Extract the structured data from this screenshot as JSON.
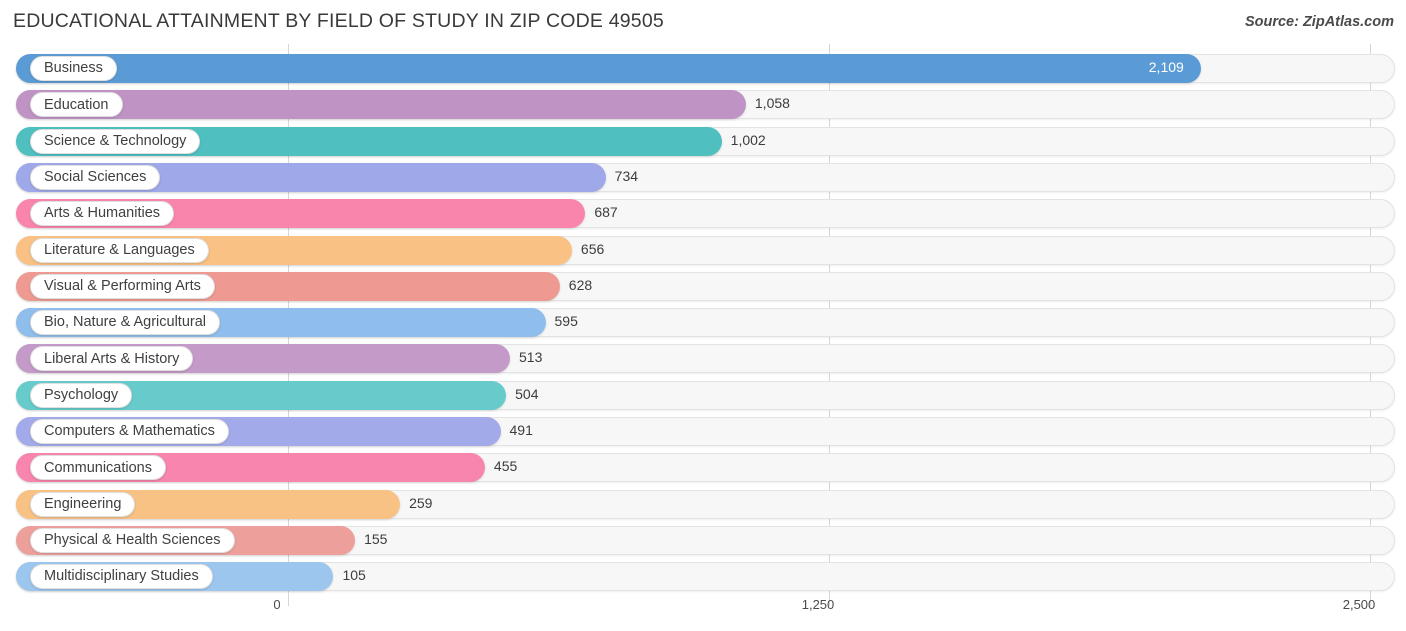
{
  "header": {
    "title": "EDUCATIONAL ATTAINMENT BY FIELD OF STUDY IN ZIP CODE 49505",
    "source": "Source: ZipAtlas.com"
  },
  "chart_data": {
    "type": "bar",
    "orientation": "horizontal",
    "title": "EDUCATIONAL ATTAINMENT BY FIELD OF STUDY IN ZIP CODE 49505",
    "xlabel": "",
    "ylabel": "",
    "xlim": [
      0,
      2500
    ],
    "grid": true,
    "legend": "none",
    "xticks": [
      "0",
      "1,250",
      "2,500"
    ],
    "xtick_values": [
      0,
      1250,
      2500
    ],
    "categories": [
      "Business",
      "Education",
      "Science & Technology",
      "Social Sciences",
      "Arts & Humanities",
      "Literature & Languages",
      "Visual & Performing Arts",
      "Bio, Nature & Agricultural",
      "Liberal Arts & History",
      "Psychology",
      "Computers & Mathematics",
      "Communications",
      "Engineering",
      "Physical & Health Sciences",
      "Multidisciplinary Studies"
    ],
    "values": [
      2109,
      1058,
      1002,
      734,
      687,
      656,
      628,
      595,
      513,
      504,
      491,
      455,
      259,
      155,
      105
    ],
    "value_labels": [
      "2,109",
      "1,058",
      "1,002",
      "734",
      "687",
      "656",
      "628",
      "595",
      "513",
      "504",
      "491",
      "455",
      "259",
      "155",
      "105"
    ],
    "colors": [
      "#5b9bd5",
      "#bf93c4",
      "#4fbfc0",
      "#9fa8e8",
      "#f985ad",
      "#f9c183",
      "#ee9a92",
      "#8fbdec",
      "#c49ac8",
      "#67cbcb",
      "#a3aaea",
      "#f785ae",
      "#f9c285",
      "#eda09b",
      "#9dc6ee"
    ]
  }
}
